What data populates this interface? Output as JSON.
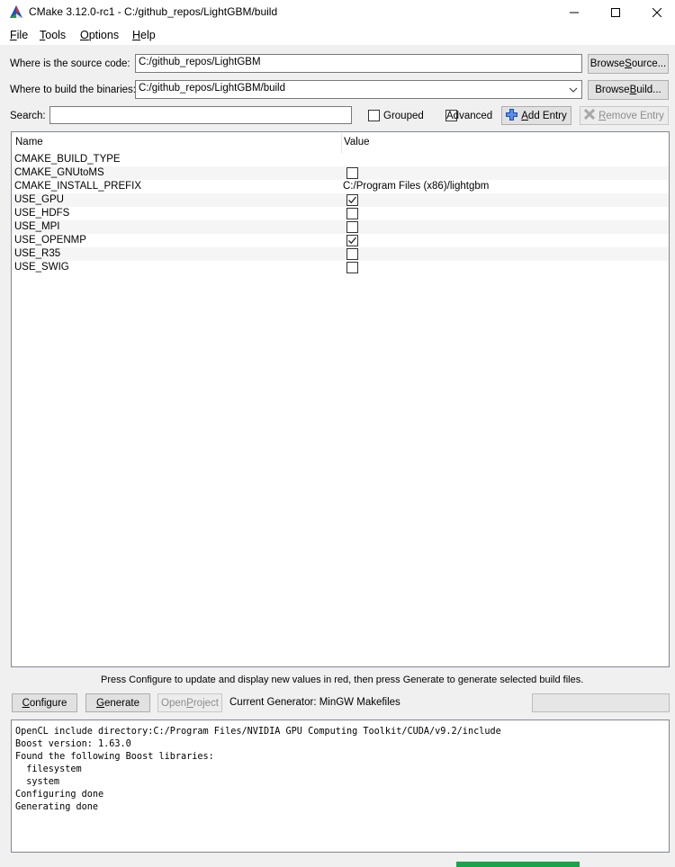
{
  "window": {
    "title": "CMake 3.12.0-rc1 - C:/github_repos/LightGBM/build",
    "app_icon": "cmake-triangle-icon"
  },
  "menu": {
    "items": [
      {
        "label": "File",
        "mnemonic": "F",
        "rest": "ile"
      },
      {
        "label": "Tools",
        "mnemonic": "T",
        "rest": "ools"
      },
      {
        "label": "Options",
        "mnemonic": "O",
        "rest": "ptions"
      },
      {
        "label": "Help",
        "mnemonic": "H",
        "rest": "elp"
      }
    ]
  },
  "source": {
    "label": "Where is the source code:",
    "value": "C:/github_repos/LightGBM",
    "browse_pre": "Browse ",
    "browse_ul": "S",
    "browse_post": "ource..."
  },
  "build": {
    "label": "Where to build the binaries:",
    "value": "C:/github_repos/LightGBM/build",
    "browse_pre": "Browse ",
    "browse_ul": "B",
    "browse_post": "uild..."
  },
  "search": {
    "label": "Search:",
    "value": "",
    "grouped_label": "Grouped",
    "advanced_label": "Advanced",
    "add_entry_ul": "A",
    "add_entry_rest": "dd Entry",
    "remove_entry_ul": "R",
    "remove_entry_rest": "emove Entry"
  },
  "table": {
    "columns": [
      "Name",
      "Value"
    ],
    "rows": [
      {
        "name": "CMAKE_BUILD_TYPE",
        "type": "text",
        "value": ""
      },
      {
        "name": "CMAKE_GNUtoMS",
        "type": "bool",
        "value": false
      },
      {
        "name": "CMAKE_INSTALL_PREFIX",
        "type": "text",
        "value": "C:/Program Files (x86)/lightgbm"
      },
      {
        "name": "USE_GPU",
        "type": "bool",
        "value": true
      },
      {
        "name": "USE_HDFS",
        "type": "bool",
        "value": false
      },
      {
        "name": "USE_MPI",
        "type": "bool",
        "value": false
      },
      {
        "name": "USE_OPENMP",
        "type": "bool",
        "value": true
      },
      {
        "name": "USE_R35",
        "type": "bool",
        "value": false
      },
      {
        "name": "USE_SWIG",
        "type": "bool",
        "value": false
      }
    ]
  },
  "status_message": "Press Configure to update and display new values in red, then press Generate to generate selected build files.",
  "actions": {
    "configure_ul": "C",
    "configure_rest": "onfigure",
    "generate_ul": "G",
    "generate_rest": "enerate",
    "open_project_pre": "Open ",
    "open_project_ul": "P",
    "open_project_post": "roject",
    "generator_text": "Current Generator: MinGW Makefiles"
  },
  "output": {
    "lines": [
      "OpenCL include directory:C:/Program Files/NVIDIA GPU Computing Toolkit/CUDA/v9.2/include",
      "Boost version: 1.63.0",
      "Found the following Boost libraries:",
      "  filesystem",
      "  system",
      "Configuring done",
      "Generating done"
    ]
  },
  "colors": {
    "accent_blue": "#2b6cd4",
    "client_bg": "#f0f0f0",
    "taskbar_green": "#1aa34a"
  }
}
